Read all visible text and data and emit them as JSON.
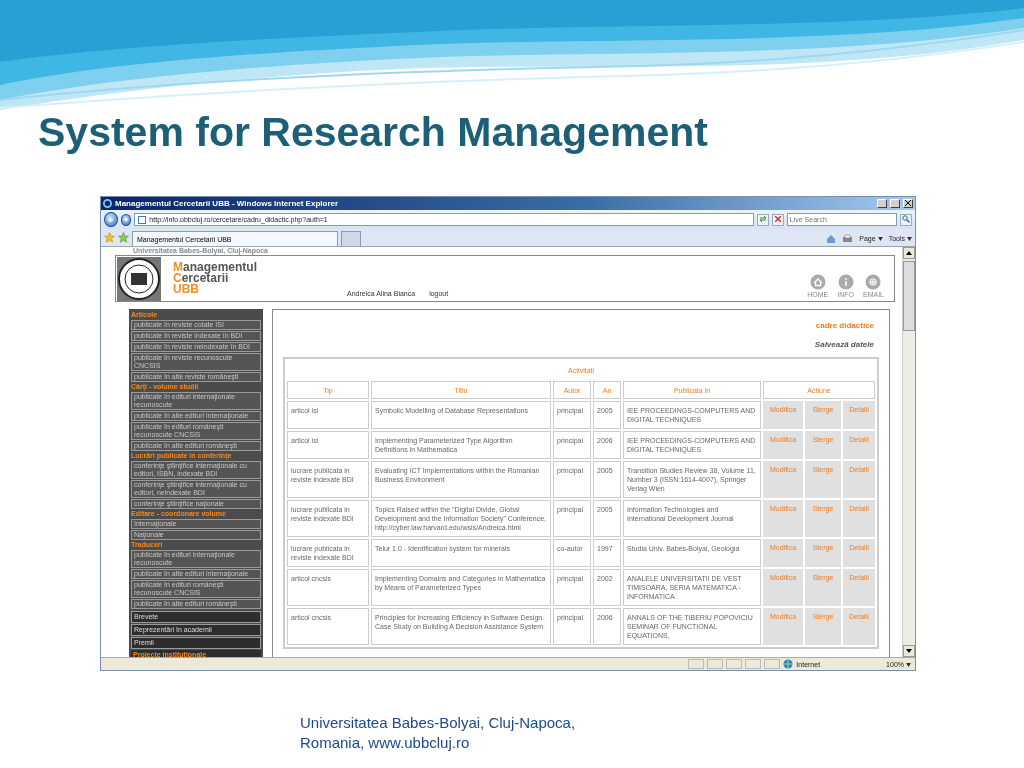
{
  "slide": {
    "title": "System for Research Management",
    "footer": [
      "Universitatea Babes-Bolyai, Cluj-Napoca,",
      "Romania, www.ubbcluj.ro"
    ]
  },
  "browser": {
    "title": "Managementul Cercetarii UBB - Windows Internet Explorer",
    "address": "http://info.ubbcluj.ro/cercetare/cadru_didactic.php?auth=1",
    "search_placeholder": "Live Search",
    "tab": "Managementul Cercetarii UBB",
    "toolbar": [
      "Page",
      "Tools"
    ],
    "status_zone": "Internet",
    "zoom": "100%"
  },
  "header": {
    "university": "Universitatea Babes-Bolyai, Cluj-Napoca",
    "brand": [
      "Managementul",
      "Cercetarii",
      "UBB"
    ],
    "user": "Andreica Alina Bianca",
    "logout": "logout",
    "nav": [
      {
        "kind": "home",
        "label": "HOME"
      },
      {
        "kind": "info",
        "label": "INFO"
      },
      {
        "kind": "email",
        "label": "EMAIL"
      }
    ]
  },
  "sidebar": [
    {
      "kind": "heading",
      "label": "Articole"
    },
    {
      "kind": "link",
      "label": "publicate în reviste cotate ISI"
    },
    {
      "kind": "link",
      "label": "publicate în reviste indexate în BDI"
    },
    {
      "kind": "link",
      "label": "publicate în reviste neindexate în BDI"
    },
    {
      "kind": "link",
      "label": "publicate în reviste recunoscute CNCSIS"
    },
    {
      "kind": "link",
      "label": "publicate în alte reviste româneşti"
    },
    {
      "kind": "heading",
      "label": "Cărţi - volume studii"
    },
    {
      "kind": "link",
      "label": "publicate în edituri internaţionale recunoscute"
    },
    {
      "kind": "link",
      "label": "publicate în alte edituri internaţionale"
    },
    {
      "kind": "link",
      "label": "publicate în edituri româneşti recunoscute CNCSIS"
    },
    {
      "kind": "link",
      "label": "publicate în alte edituri româneşti"
    },
    {
      "kind": "heading",
      "label": "Lucrări publicate în conferinţe"
    },
    {
      "kind": "link",
      "label": "conferinţe ştiinţifice internaţionale cu editori, ISBN, indexate BDI"
    },
    {
      "kind": "link",
      "label": "conferinţe ştiinţifice internaţionale cu editori, neindexate BDI"
    },
    {
      "kind": "link",
      "label": "conferinţe ştiinţifice naţionale"
    },
    {
      "kind": "heading",
      "label": "Editare - coordonare volume"
    },
    {
      "kind": "link",
      "label": "Internaţionale"
    },
    {
      "kind": "link",
      "label": "Naţionale"
    },
    {
      "kind": "heading",
      "label": "Traduceri"
    },
    {
      "kind": "link",
      "label": "publicate în edituri internaţionale recunoscute"
    },
    {
      "kind": "link",
      "label": "publicate în alte edituri internaţionale"
    },
    {
      "kind": "link",
      "label": "publicate în edituri româneşti recunoscute CNCSIS"
    },
    {
      "kind": "link",
      "label": "publicate în alte edituri româneşti"
    },
    {
      "kind": "block",
      "label": "Brevete"
    },
    {
      "kind": "block",
      "label": "Reprezentări în academii"
    },
    {
      "kind": "block",
      "label": "Premii"
    },
    {
      "kind": "block-heading",
      "label": "Proiecte institutionale"
    }
  ],
  "content": {
    "section": "cadre didactice",
    "save": "Salvează datele",
    "table": {
      "caption": "Activitati",
      "columns": [
        "Tip",
        "Titlu",
        "Autor",
        "An",
        "Publicata in",
        "Actiune"
      ],
      "rows": [
        {
          "tip": "articol isi",
          "titlu": "Symbolic Modelling of Database Representations",
          "autor": "principal",
          "an": "2005",
          "publicata": "IEE PROCEEDINGS-COMPUTERS AND DIGITAL TECHNIQUES",
          "actions": [
            "Modifica",
            "Sterge",
            "Detalii"
          ]
        },
        {
          "tip": "articol isi",
          "titlu": "Implementing Parameterized Type Algorithm Definitions in Mathematica",
          "autor": "principal",
          "an": "2006",
          "publicata": "IEE PROCEEDINGS-COMPUTERS AND DIGITAL TECHNIQUES",
          "actions": [
            "Modifica",
            "Sterge",
            "Detalii"
          ]
        },
        {
          "tip": "lucrare publicata in reviste indexate BDI",
          "titlu": "Evaluating ICT Implementations within the Romanian Business Environment",
          "autor": "principal",
          "an": "2005",
          "publicata": "Transition Studies Review 38, Volume 11, Number 3 (ISSN:1614-4007), Springer Verlag Wien",
          "actions": [
            "Modifica",
            "Sterge",
            "Detalii"
          ]
        },
        {
          "tip": "lucrare publicata in reviste indexate BDI",
          "titlu": "Topics Raised within the \"Digital Divide, Global Development and the Information Society\" Conference, http://cyber.law.harvard.edu/wsis/Andreica.html",
          "autor": "principal",
          "an": "2005",
          "publicata": "Information Technologies and International Development Journal",
          "actions": [
            "Modifica",
            "Sterge",
            "Detalii"
          ]
        },
        {
          "tip": "lucrare publicata in reviste indexate BDI",
          "titlu": "Telur 1.0 - Identification system for minerals",
          "autor": "co-autor",
          "an": "1997",
          "publicata": "Studia Univ. Babes-Bolyai, Geologia",
          "actions": [
            "Modifica",
            "Sterge",
            "Detalii"
          ]
        },
        {
          "tip": "articol cncsis",
          "titlu": "Implementing Domains and Categories in Mathematica by Means of Parameterized Types",
          "autor": "principal",
          "an": "2002",
          "publicata": "ANALELE UNIVERSITATII DE VEST TIMISOARA, SERIA MATEMATICA - INFORMATICA",
          "actions": [
            "Modifica",
            "Sterge",
            "Detalii"
          ]
        },
        {
          "tip": "articol cncsis",
          "titlu": "Principles for Increasing Efficiency in Software Design. Case Study on Building A Decision Assistance System",
          "autor": "principal",
          "an": "2006",
          "publicata": "ANNALS OF THE TIBERIU POPOVICIU SEMINAR OF FUNCTIONAL EQUATIONS,",
          "actions": [
            "Modifica",
            "Sterge",
            "Detalii"
          ]
        }
      ]
    }
  }
}
